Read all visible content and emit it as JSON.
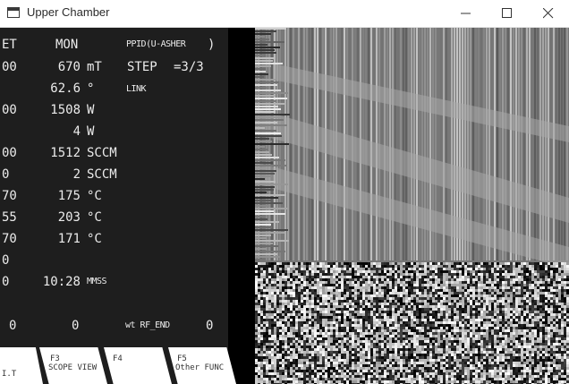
{
  "window": {
    "title": "Upper Chamber",
    "icons": [
      "app-window-icon",
      "minimize-icon",
      "maximize-icon",
      "close-icon"
    ]
  },
  "terminal": {
    "header": {
      "col1": "ET",
      "col2": "MON",
      "mode": "PPID(U-ASHER",
      "mode_close": ")"
    },
    "step": {
      "label": "STEP",
      "value": "=3/3"
    },
    "link": "LINK",
    "rows": [
      {
        "set": "00",
        "mon": "670",
        "unit": "mT"
      },
      {
        "set": "",
        "mon": "62.6",
        "unit": "°"
      },
      {
        "set": "00",
        "mon": "1508",
        "unit": "W"
      },
      {
        "set": "",
        "mon": "4",
        "unit": "W"
      },
      {
        "set": "00",
        "mon": "1512",
        "unit": "SCCM"
      },
      {
        "set": "0",
        "mon": "2",
        "unit": "SCCM"
      },
      {
        "set": "70",
        "mon": "175",
        "unit": "°C"
      },
      {
        "set": "55",
        "mon": "203",
        "unit": "°C"
      },
      {
        "set": "70",
        "mon": "171",
        "unit": "°C"
      },
      {
        "set": "0",
        "mon": "",
        "unit": ""
      },
      {
        "set": "0",
        "mon": "10:28",
        "unit": "MMSS"
      }
    ],
    "footer": {
      "left": "0",
      "middle": "0",
      "label": "wt RF_END",
      "right": "0"
    }
  },
  "function_keys": [
    {
      "top": "",
      "bottom": "I.T"
    },
    {
      "top": "F3",
      "bottom": "SCOPE VIEW"
    },
    {
      "top": "F4",
      "bottom": ""
    },
    {
      "top": "F5",
      "bottom": "Other FUNC"
    }
  ],
  "colors": {
    "terminal_bg": "#1e1e1e",
    "terminal_text": "#ececec",
    "divider": "#000000"
  }
}
